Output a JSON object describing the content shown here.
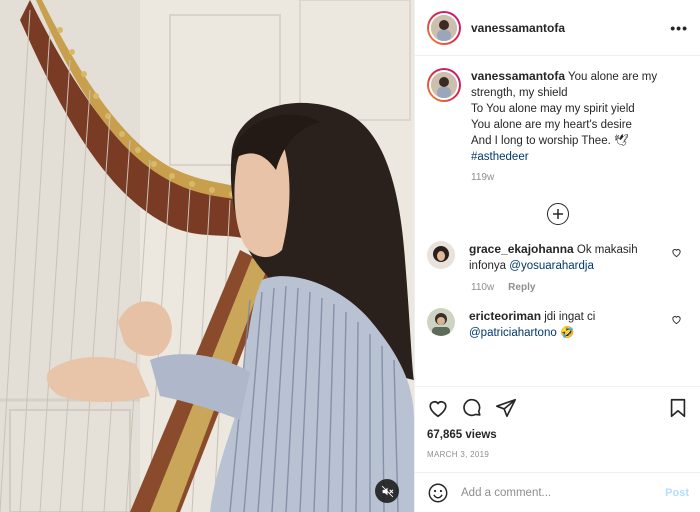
{
  "post": {
    "username": "vanessamantofa",
    "more_icon": "more-horizontal-icon",
    "caption": {
      "username": "vanessamantofa",
      "lines": [
        "You alone are my",
        "strength, my shield",
        "To You alone may my spirit yield",
        "You alone are my heart's desire",
        "And I long to worship Thee. 🕊"
      ],
      "hashtag": "#asthedeer",
      "age": "119w"
    },
    "load_more_icon": "plus-circle-icon",
    "comments": [
      {
        "username": "grace_ekajohanna",
        "text": " Ok makasih infonya ",
        "mention": "@yosuarahardja",
        "age": "110w",
        "reply_label": "Reply"
      },
      {
        "username": "ericteoriman",
        "text": " jdi ingat ci ",
        "mention": "@patriciahartono",
        "suffix": " 🤣"
      }
    ],
    "views": "67,865 views",
    "date": "March 3, 2019",
    "comment_placeholder": "Add a comment...",
    "post_label": "Post",
    "colors": {
      "link": "#00376b",
      "post_disabled": "#b2dffc",
      "muted": "#8e8e8e"
    }
  }
}
